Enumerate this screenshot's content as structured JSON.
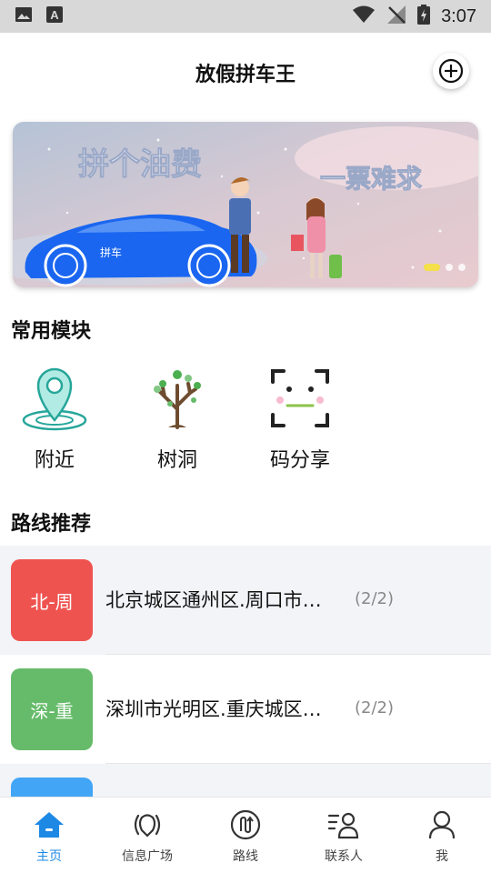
{
  "status_bar": {
    "time": "3:07"
  },
  "header": {
    "title": "放假拼车王"
  },
  "banner": {
    "headline_left": "拼个油费",
    "headline_right": "一票难求",
    "car_text": "拼车",
    "active_dot": 0,
    "dot_count": 3,
    "accent": "#2b6ef5"
  },
  "modules": {
    "title": "常用模块",
    "items": [
      {
        "label": "附近",
        "icon": "location-pin-icon"
      },
      {
        "label": "树洞",
        "icon": "tree-icon"
      },
      {
        "label": "码分享",
        "icon": "scan-code-icon"
      }
    ]
  },
  "routes": {
    "title": "路线推荐",
    "items": [
      {
        "badge": "北-周",
        "text": "北京城区通州区.周口市…",
        "count": "(2/2)",
        "color": "#ef5350"
      },
      {
        "badge": "深-重",
        "text": "深圳市光明区.重庆城区…",
        "count": "(2/2)",
        "color": "#66bb6a"
      },
      {
        "badge": "",
        "text": "",
        "count": "",
        "color": "#42a5f5"
      }
    ]
  },
  "bottom_nav": {
    "active_color": "#1e88e5",
    "items": [
      {
        "label": "主页",
        "icon": "home-icon",
        "active": true
      },
      {
        "label": "信息广场",
        "icon": "broadcast-icon",
        "active": false
      },
      {
        "label": "路线",
        "icon": "route-icon",
        "active": false
      },
      {
        "label": "联系人",
        "icon": "contacts-icon",
        "active": false
      },
      {
        "label": "我",
        "icon": "profile-icon",
        "active": false
      }
    ]
  }
}
